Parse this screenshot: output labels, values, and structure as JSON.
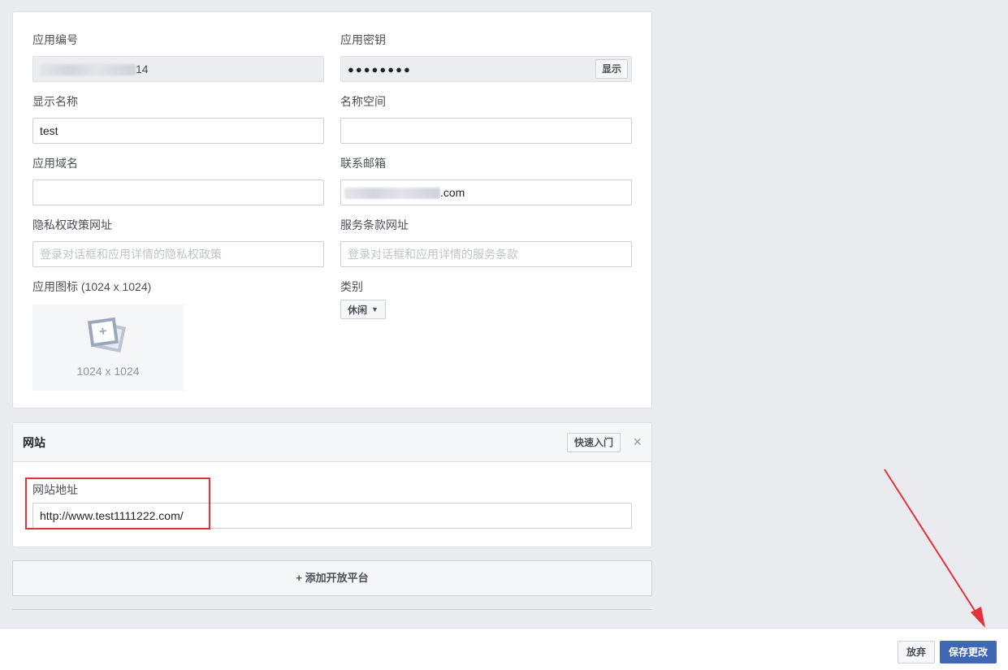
{
  "basic": {
    "app_id": {
      "label": "应用编号",
      "value_suffix": "14"
    },
    "app_secret": {
      "label": "应用密钥",
      "value": "●●●●●●●●",
      "show_button": "显示"
    },
    "display_name": {
      "label": "显示名称",
      "value": "test"
    },
    "namespace": {
      "label": "名称空间",
      "value": ""
    },
    "app_domains": {
      "label": "应用域名",
      "value": ""
    },
    "contact_email": {
      "label": "联系邮箱",
      "value_suffix": ".com"
    },
    "privacy_url": {
      "label": "隐私权政策网址",
      "placeholder": "登录对话框和应用详情的隐私权政策"
    },
    "terms_url": {
      "label": "服务条款网址",
      "placeholder": "登录对话框和应用详情的服务条款"
    },
    "app_icon": {
      "label": "应用图标 (1024 x 1024)",
      "size_text": "1024 x 1024"
    },
    "category": {
      "label": "类别",
      "value": "休闲"
    }
  },
  "website": {
    "title": "网站",
    "quick_start": "快速入门",
    "close": "×",
    "site_url": {
      "label": "网站地址",
      "value": "http://www.test1111222.com/"
    }
  },
  "add_platform": "+ 添加开放平台",
  "footer": {
    "discard": "放弃",
    "save": "保存更改"
  },
  "annotation": {
    "highlight_color": "#e0333a",
    "arrow_color": "#e0333a"
  }
}
